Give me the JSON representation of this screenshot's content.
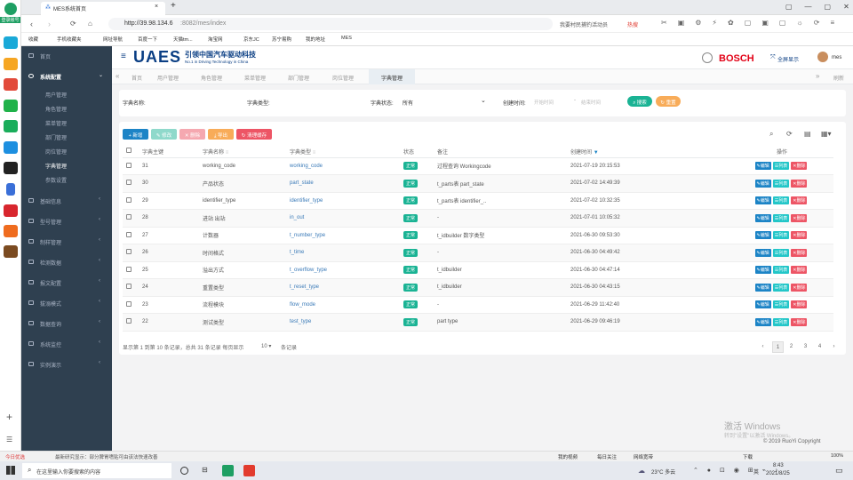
{
  "browser": {
    "tab_title": "MES系统首页",
    "url_host": "http://39.98.134.6",
    "url_rest": ":8082/mes/index",
    "search_text": "我要村民捕钓活动员",
    "search_badge": "热搜",
    "new_tab": "+"
  },
  "bookmarks": [
    "收藏",
    "手机收藏夹",
    "网址导航",
    "百度一下",
    "天猫tm...",
    "淘宝网",
    "京东JC",
    "苏宁易购",
    "我的地址",
    "MES"
  ],
  "left_rail": {
    "login_label": "登录账号"
  },
  "sidebar": {
    "home": "首页",
    "section": "系统配置",
    "sub_items": [
      "用户管理",
      "角色管理",
      "菜单管理",
      "部门管理",
      "岗位管理",
      "字典管理",
      "参数设置"
    ],
    "active_sub": "字典管理",
    "groups": [
      "基础信息",
      "型号管理",
      "制样管理",
      "检测数据",
      "报文配置",
      "拔溺模式",
      "数据查询",
      "系统监控",
      "实例演示"
    ],
    "chevron": "‹"
  },
  "header": {
    "logo": "UAES",
    "cn_name": "引领中国汽车驱动科技",
    "en_tagline": "No.1 in Driving Technology in China",
    "bosch": "BOSCH",
    "fullscreen": "全屏显示",
    "user": "mes"
  },
  "tabs": {
    "nav_left": "«",
    "nav_right": "»",
    "refresh": "刷新",
    "items": [
      "首页",
      "用户管理",
      "角色管理",
      "菜单管理",
      "部门管理",
      "岗位管理",
      "字典管理"
    ],
    "active": "字典管理"
  },
  "search": {
    "name_label": "字典名称:",
    "type_label": "字典类型:",
    "status_label": "字典状态:",
    "status_value": "所有",
    "time_label": "创建时间:",
    "start_placeholder": "开始时间",
    "dash": "-",
    "end_placeholder": "结束时间",
    "search_btn": "搜索",
    "reset_btn": "重置"
  },
  "toolbar": {
    "add": "新增",
    "edit": "修改",
    "delete": "删除",
    "export": "导出",
    "refresh_cache": "清理缓存"
  },
  "colors": {
    "primary": "#1c84c6",
    "success": "#1ab394",
    "warning": "#f8ac59",
    "danger": "#ed5565",
    "sidebar": "#2f4050",
    "header_blue": "#0b3f84",
    "bosch_red": "#e20015"
  },
  "table": {
    "headers": [
      "字典主键",
      "字典名称",
      "字典类型",
      "状态",
      "备注",
      "创建时间",
      "操作"
    ],
    "status_label": "正常",
    "ops": [
      "编辑",
      "列表",
      "删除"
    ],
    "rows": [
      {
        "id": "31",
        "name": "working_code",
        "type": "working_code",
        "remark": "过程查询 Workingcode",
        "time": "2021-07-19 20:15:53"
      },
      {
        "id": "30",
        "name": "产品状态",
        "type": "part_state",
        "remark": "t_parts表 part_state",
        "time": "2021-07-02 14:49:39"
      },
      {
        "id": "29",
        "name": "identifier_type",
        "type": "identifier_type",
        "remark": "t_parts表 identifier_..",
        "time": "2021-07-02 10:32:35"
      },
      {
        "id": "28",
        "name": "进站 出站",
        "type": "in_out",
        "remark": "-",
        "time": "2021-07-01 10:05:32"
      },
      {
        "id": "27",
        "name": "计数器",
        "type": "t_number_type",
        "remark": "t_idbuilder 数字类型",
        "time": "2021-06-30 09:53:30"
      },
      {
        "id": "26",
        "name": "时间格式",
        "type": "t_time",
        "remark": "-",
        "time": "2021-06-30 04:49:42"
      },
      {
        "id": "25",
        "name": "溢出方式",
        "type": "t_overflow_type",
        "remark": "t_idbuilder",
        "time": "2021-06-30 04:47:14"
      },
      {
        "id": "24",
        "name": "重置类型",
        "type": "t_reset_type",
        "remark": "t_idbuilder",
        "time": "2021-06-30 04:43:15"
      },
      {
        "id": "23",
        "name": "流程模块",
        "type": "flow_mode",
        "remark": "-",
        "time": "2021-06-29 11:42:40"
      },
      {
        "id": "22",
        "name": "测试类型",
        "type": "test_type",
        "remark": "part type",
        "time": "2021-06-29 09:46:19"
      }
    ]
  },
  "pagination": {
    "summary": "显示第 1 到第 10 条记录，总共 31 条记录  每页显示",
    "page_size": "10",
    "suffix": "条记录",
    "pages": [
      "‹",
      "1",
      "2",
      "3",
      "4",
      "›"
    ],
    "current": "1"
  },
  "watermark": {
    "line1": "激活 Windows",
    "line2": "转到\"设置\"以激活 Windows。"
  },
  "copyright": "© 2019 RuoYi Copyright",
  "statusbar": {
    "left1": "今日优选",
    "left2": "最新研究显示：部分脾胃嗜贴可由该法快速改善",
    "items": [
      "我的视频",
      "每日关注",
      "网络宽带",
      "下载",
      "100%"
    ]
  },
  "taskbar": {
    "search_placeholder": "在这里输入你要搜索的内容",
    "weather": "23°C 多云",
    "ime": "英",
    "time": "8:43",
    "date": "2021/8/25"
  }
}
